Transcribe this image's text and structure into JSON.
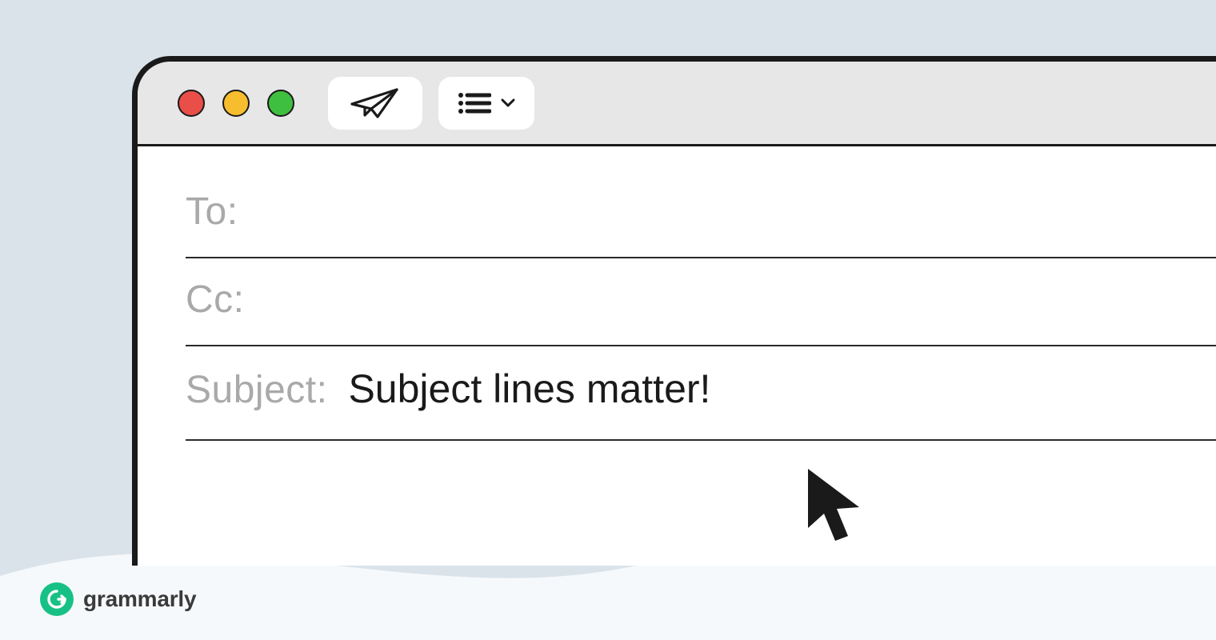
{
  "window": {
    "traffic": {
      "close": {
        "name": "close-dot",
        "color": "#ea4e48"
      },
      "minimize": {
        "name": "minimize-dot",
        "color": "#f6bd2e"
      },
      "zoom": {
        "name": "zoom-dot",
        "color": "#3fbf3f"
      }
    },
    "toolbar": {
      "send_icon": "paper-plane-icon",
      "list_icon": "list-icon",
      "dropdown_icon": "chevron-down-icon"
    },
    "fields": {
      "to": {
        "label": "To:",
        "value": ""
      },
      "cc": {
        "label": "Cc:",
        "value": ""
      },
      "subject": {
        "label": "Subject:",
        "value": "Subject lines matter!"
      }
    }
  },
  "brand": {
    "name": "grammarly",
    "badge_letter": "G",
    "accent": "#17c185"
  },
  "colors": {
    "background": "#dbe3ea",
    "ink": "#1a1a1a",
    "muted_label": "#a9a9a9",
    "titlebar": "#e7e7e7"
  }
}
